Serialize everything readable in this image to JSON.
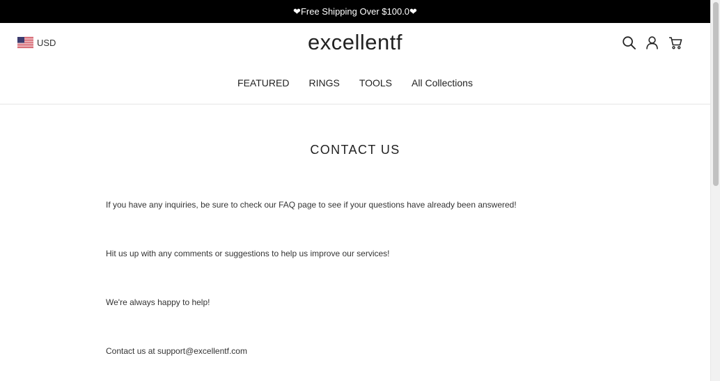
{
  "announcement": {
    "text": "❤Free Shipping Over $100.0❤"
  },
  "header": {
    "currency": "USD",
    "logo": "excellentf",
    "icons": [
      "search-icon",
      "account-icon",
      "cart-icon"
    ]
  },
  "nav": {
    "items": [
      {
        "label": "FEATURED"
      },
      {
        "label": "RINGS"
      },
      {
        "label": "TOOLS"
      },
      {
        "label": "All Collections"
      }
    ]
  },
  "main": {
    "title": "CONTACT US",
    "paragraphs": [
      "If you have any inquiries, be sure to check our FAQ page to see if your questions have already been answered!",
      "Hit us up with any comments or suggestions to help us improve our services!",
      "We're always happy to help!",
      "Contact us at support@excellentf.com"
    ]
  },
  "colors": {
    "announcement_bg": "#000000",
    "announcement_text": "#ffffff",
    "body_text": "#333333"
  }
}
